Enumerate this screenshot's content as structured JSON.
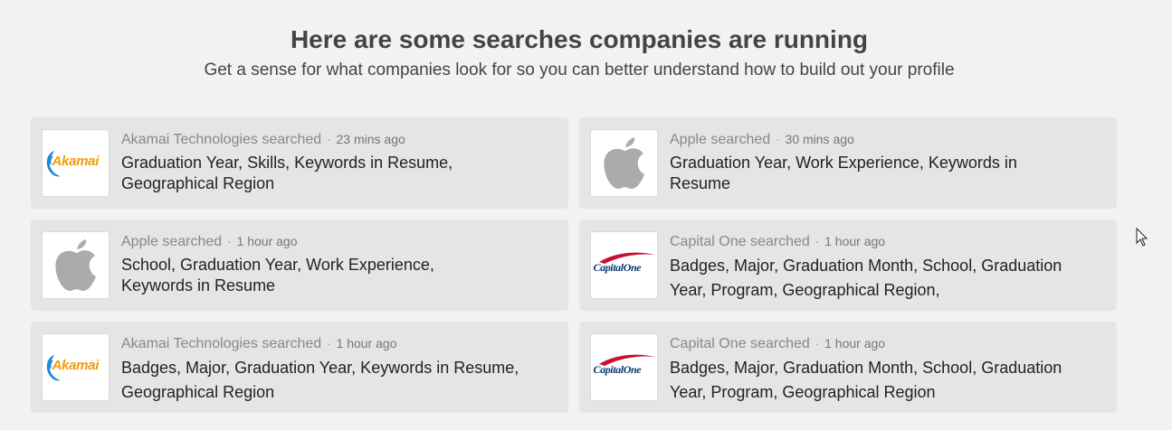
{
  "header": {
    "title": "Here are some searches companies are running",
    "subtitle": "Get a sense for what companies look for so you can better understand how to build out your profile"
  },
  "colors": {
    "background": "#f2f2f2",
    "card": "#e5e5e5",
    "akamai_orange": "#f59a00",
    "akamai_blue": "#1e88d6",
    "apple_gray": "#a9abad",
    "capital_one_navy": "#0b3a72",
    "capital_one_red": "#c8102e"
  },
  "cards": [
    {
      "logo": "akamai-logo",
      "logo_text": "Akamai",
      "company": "Akamai Technologies searched",
      "separator": "·",
      "time": "23 mins ago",
      "criteria": "Graduation Year, Skills, Keywords in Resume, Geographical Region"
    },
    {
      "logo": "apple-logo",
      "company": "Apple searched",
      "separator": "·",
      "time": "30 mins ago",
      "criteria": "Graduation Year, Work Experience, Keywords in Resume"
    },
    {
      "logo": "apple-logo",
      "company": "Apple searched",
      "separator": "·",
      "time": "1 hour ago",
      "criteria": "School, Graduation Year, Work Experience, Keywords in Resume"
    },
    {
      "logo": "capital-one-logo",
      "logo_text": "CapitalOne",
      "company": "Capital One searched",
      "separator": "·",
      "time": "1 hour ago",
      "criteria": "Badges, Major, Graduation Month, School, Graduation Year, Program, Geographical Region,"
    },
    {
      "logo": "akamai-logo",
      "logo_text": "Akamai",
      "company": "Akamai Technologies searched",
      "separator": "·",
      "time": "1 hour ago",
      "criteria": "Badges, Major, Graduation Year, Keywords in Resume, Geographical Region"
    },
    {
      "logo": "capital-one-logo",
      "logo_text": "CapitalOne",
      "company": "Capital One searched",
      "separator": "·",
      "time": "1 hour ago",
      "criteria": "Badges, Major, Graduation Month, School, Graduation Year, Program, Geographical Region"
    }
  ],
  "cursor": {
    "icon": "mouse-pointer-icon"
  }
}
